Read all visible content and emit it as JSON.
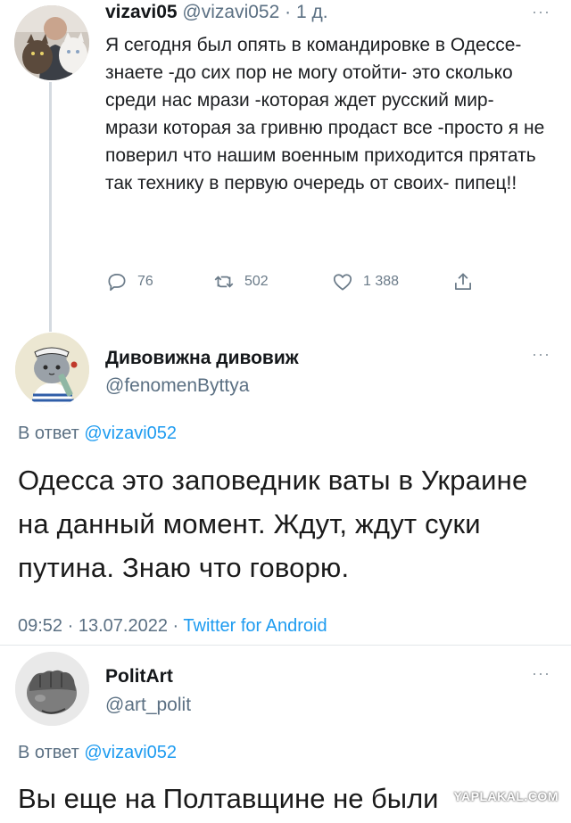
{
  "tweet1": {
    "display_name": "vizavi05",
    "handle": "@vizavi052",
    "separator": "·",
    "time_ago": "1 д.",
    "text": "Я сегодня был опять в командировке в Одессе- знаете -до сих пор не могу отойти- это сколько среди нас мрази -которая ждет русский мир- мрази которая за гривню продаст все -просто я не поверил что нашим военным приходится прятать так технику в первую очередь от своих- пипец!!",
    "actions": {
      "reply_count": "76",
      "retweet_count": "502",
      "like_count": "1 388"
    },
    "avatar_icon": "profile-photo-with-cats",
    "more_icon": "more-dots-icon"
  },
  "tweet2": {
    "display_name": "Дивовижна дивовиж",
    "handle": "@fenomenByttya",
    "reply_prefix": "В ответ",
    "reply_to": "@vizavi052",
    "text": "Одесса это заповедник ваты в Украине на данный момент. Ждут, ждут суки путина. Знаю что говорю.",
    "time": "09:52",
    "dot": "·",
    "date": "13.07.2022",
    "source": "Twitter for Android",
    "avatar_icon": "cat-sailor-avatar"
  },
  "tweet3": {
    "display_name": "PolitArt",
    "handle": "@art_polit",
    "reply_prefix": "В ответ",
    "reply_to": "@vizavi052",
    "text": "Вы еще на Полтавщине не были",
    "avatar_icon": "fist-avatar"
  },
  "watermark": "YAPLAKAL.COM",
  "colors": {
    "link": "#1d9bf0",
    "muted": "#5b7083",
    "text": "#14171a",
    "icon": "#6b7b89"
  }
}
